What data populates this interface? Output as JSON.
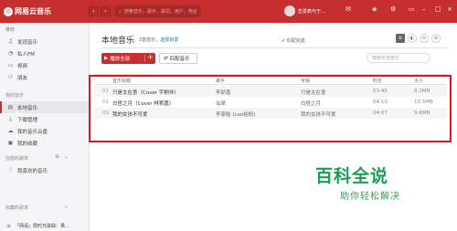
{
  "topbar": {
    "app_name": "网易云音乐",
    "back_label": "‹",
    "forward_label": "›",
    "search_placeholder": "搜索音乐，歌手，歌词，用户，电台",
    "username": "恋爱疯与于...",
    "accent": "#c62f2f"
  },
  "sidebar": {
    "recommend_title": "推荐",
    "recommend_items": [
      {
        "label": "发现音乐",
        "icon": "music-note-icon"
      },
      {
        "label": "私人FM",
        "icon": "radio-icon"
      },
      {
        "label": "视频",
        "icon": "video-icon"
      },
      {
        "label": "朋友",
        "icon": "friends-icon"
      }
    ],
    "my_music_title": "我的音乐",
    "my_music_items": [
      {
        "label": "本地音乐",
        "icon": "local-music-icon",
        "active": true
      },
      {
        "label": "下载管理",
        "icon": "download-icon"
      },
      {
        "label": "我的音乐云盘",
        "icon": "cloud-icon"
      },
      {
        "label": "我的收藏",
        "icon": "collection-icon"
      }
    ],
    "created_title": "创建的歌单",
    "created_items": [
      {
        "label": "我喜欢的音乐",
        "icon": "heart-icon"
      }
    ],
    "collected_title": "收藏的歌单",
    "collected_items": [
      {
        "label": "「网译」限时光歌曲：果...",
        "icon": "playlist-icon"
      }
    ]
  },
  "main": {
    "title": "本地音乐",
    "count_text": "3首音乐，",
    "choose_dir": "选择目录",
    "status_text": "匹配完成",
    "play_all": "播放全部",
    "play_add": "+",
    "match_music": "匹配音乐",
    "search_placeholder": "搜索本地音乐",
    "view_list": "≡",
    "view_album": "◐",
    "view_artist": "⊙"
  },
  "table": {
    "headers": [
      "音乐标题",
      "歌手",
      "专辑",
      "时长",
      "大小"
    ],
    "rows": [
      {
        "num": "01",
        "title": "只是太在意（Cover 宇桐非）",
        "artist": "李助香",
        "album": "只是太在意",
        "time": "03:45",
        "size": "9.1MB"
      },
      {
        "num": "02",
        "title": "白昼之月（Cover 林宥嘉）",
        "artist": "仙昂",
        "album": "白昼之月",
        "time": "04:10",
        "size": "10.5MB"
      },
      {
        "num": "03",
        "title": "我的女孩不可爱",
        "artist": "李家晗 (Lao始妈)",
        "album": "我的女孩不可爱",
        "time": "04:07",
        "size": "9.6MB"
      }
    ]
  },
  "watermark": {
    "logo": "百科全说",
    "tagline": "助你轻松解决"
  }
}
